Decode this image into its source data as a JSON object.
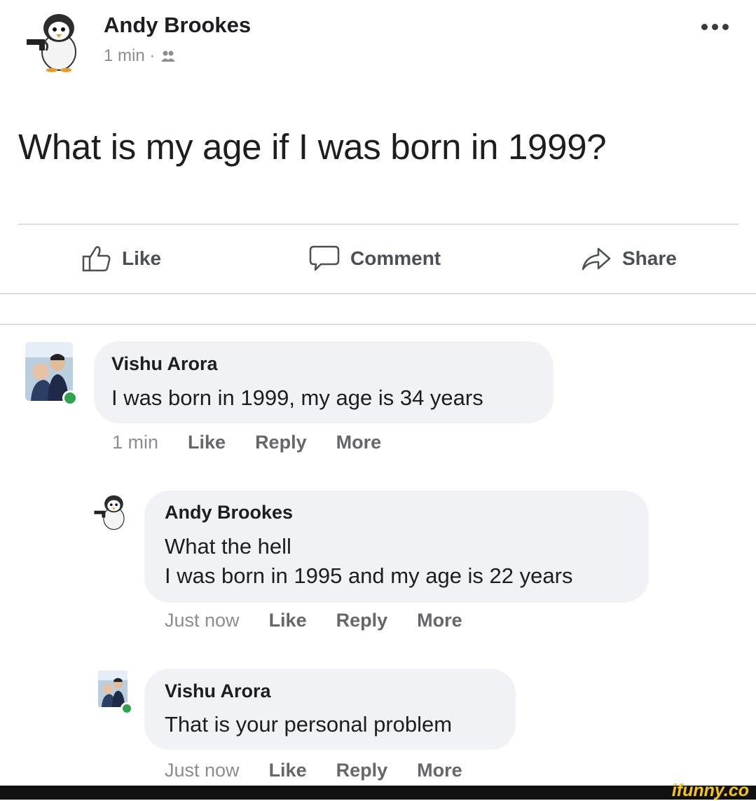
{
  "post": {
    "author": "Andy Brookes",
    "time": "1 min ·",
    "audience_icon": "friends-icon",
    "text": "What is my age if I was born in 1999?"
  },
  "actions": {
    "like": "Like",
    "comment": "Comment",
    "share": "Share"
  },
  "comments": [
    {
      "author": "Vishu Arora",
      "line1": "I was born in 1999, my age is 34 years",
      "time": "1 min",
      "like": "Like",
      "reply": "Reply",
      "more": "More"
    },
    {
      "author": "Andy Brookes",
      "line1": "What the hell",
      "line2": "I was born in 1995 and my age is 22 years",
      "time": "Just now",
      "like": "Like",
      "reply": "Reply",
      "more": "More"
    },
    {
      "author": "Vishu Arora",
      "line1": "That is your personal problem",
      "time": "Just now",
      "like": "Like",
      "reply": "Reply",
      "more": "More"
    }
  ],
  "watermark": "ifunny.co",
  "colors": {
    "bubble": "#f0f2f5",
    "online": "#31a24c",
    "muted": "#8a8d91",
    "watermark": "#f5c518"
  }
}
